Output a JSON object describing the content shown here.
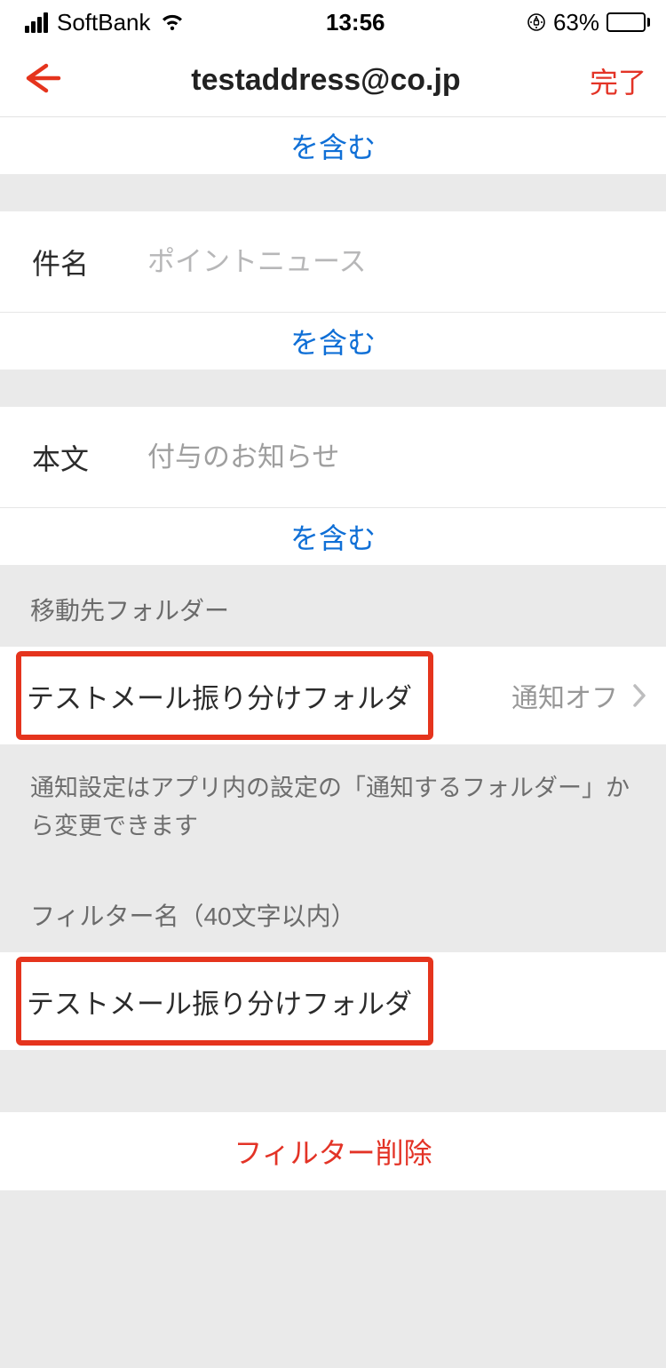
{
  "status": {
    "carrier": "SoftBank",
    "time": "13:56",
    "battery_pct": "63%"
  },
  "nav": {
    "title": "testaddress@co.jp",
    "done": "完了"
  },
  "condition1": {
    "contains": "を含む"
  },
  "subject": {
    "label": "件名",
    "placeholder": "ポイントニュース",
    "contains": "を含む"
  },
  "body": {
    "label": "本文",
    "placeholder": "付与のお知らせ",
    "contains": "を含む"
  },
  "dest_folder": {
    "header": "移動先フォルダー",
    "value": "テストメール振り分けフォルダ",
    "notify_status": "通知オフ"
  },
  "notice": "通知設定はアプリ内の設定の「通知するフォルダー」から変更できます",
  "filter_name": {
    "header": "フィルター名（40文字以内）",
    "value": "テストメール振り分けフォルダ"
  },
  "delete_label": "フィルター削除"
}
